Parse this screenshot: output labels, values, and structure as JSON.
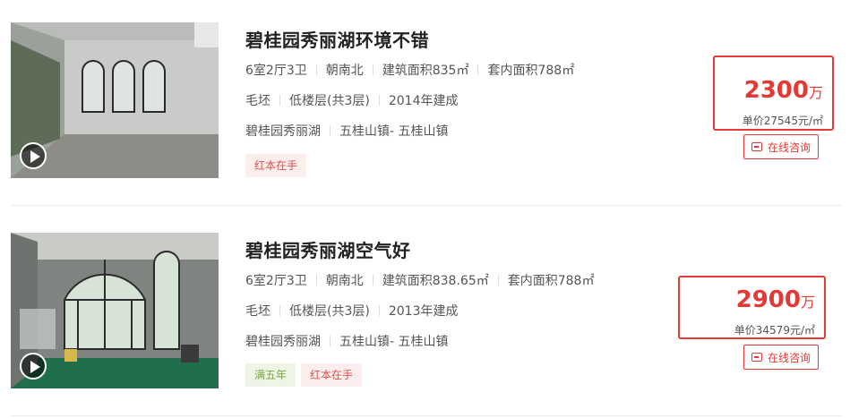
{
  "listings": [
    {
      "title": "碧桂园秀丽湖环境不错",
      "layout": "6室2厅3卫",
      "orientation": "朝南北",
      "build_area": "建筑面积835㎡",
      "inner_area": "套内面积788㎡",
      "decoration": "毛坯",
      "floor": "低楼层(共3层)",
      "year": "2014年建成",
      "community": "碧桂园秀丽湖",
      "district": "五桂山镇- 五桂山镇",
      "tags": [
        "红本在手"
      ],
      "price_number": "2300",
      "price_unit_label": "万",
      "unit_price": "单价27545元/㎡",
      "consult_label": "在线咨询"
    },
    {
      "title": "碧桂园秀丽湖空气好",
      "layout": "6室2厅3卫",
      "orientation": "朝南北",
      "build_area": "建筑面积838.65㎡",
      "inner_area": "套内面积788㎡",
      "decoration": "毛坯",
      "floor": "低楼层(共3层)",
      "year": "2013年建成",
      "community": "碧桂园秀丽湖",
      "district": "五桂山镇- 五桂山镇",
      "tags": [
        "满五年",
        "红本在手"
      ],
      "price_number": "2900",
      "price_unit_label": "万",
      "unit_price": "单价34579元/㎡",
      "consult_label": "在线咨询"
    }
  ],
  "colors": {
    "accent": "#e53935",
    "tag_red_bg": "#fdeeee",
    "tag_green_bg": "#eef5e6"
  }
}
